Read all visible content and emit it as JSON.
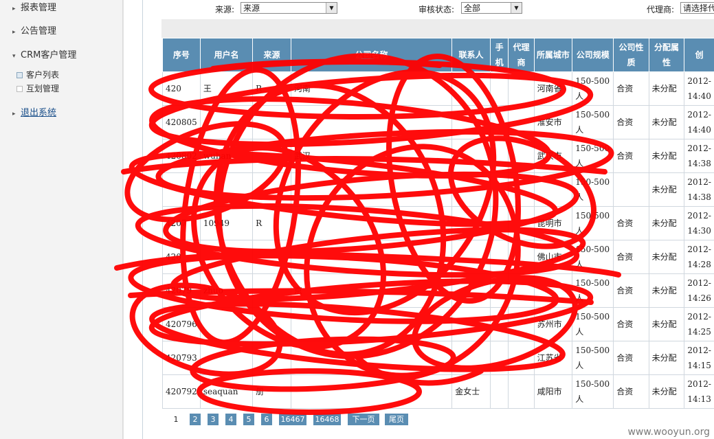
{
  "sidebar": {
    "items": [
      {
        "label": "报表管理",
        "arrow": "▸"
      },
      {
        "label": "公告管理",
        "arrow": "▸"
      },
      {
        "label": "CRM客户管理",
        "arrow": "▾"
      }
    ],
    "subitems": [
      {
        "label": "客户列表",
        "icon": "square-icon"
      },
      {
        "label": "互划管理",
        "icon": "square-icon"
      }
    ],
    "logout": {
      "label": "退出系统",
      "arrow": "▸"
    }
  },
  "filters": {
    "source": {
      "label": "来源:",
      "value": "来源"
    },
    "audit": {
      "label": "审核状态:",
      "value": "全部"
    },
    "agent": {
      "label": "代理商:",
      "value": "请选择代"
    }
  },
  "table": {
    "headers": [
      "序号",
      "用户名",
      "来源",
      "公司名称",
      "联系人",
      "手机",
      "代理商",
      "所属城市",
      "公司规模",
      "公司性质",
      "分配属性",
      "创"
    ],
    "rows": [
      [
        "420",
        "王",
        "R",
        "河南",
        "",
        "",
        "",
        "河南省",
        "150-500人",
        "合资",
        "未分配",
        "2012-14:40"
      ],
      [
        "420805",
        "",
        "",
        "",
        "",
        "",
        "",
        "淮安市",
        "150-500人",
        "合资",
        "未分配",
        "2012-14:40"
      ],
      [
        "420802",
        "wuhan",
        "",
        "武汉",
        "",
        "",
        "",
        "武汉市",
        "150-500人",
        "合资",
        "未分配",
        "2012-14:38"
      ],
      [
        "",
        "",
        "",
        "",
        "",
        "",
        "",
        "",
        "150-500人",
        "",
        "未分配",
        "2012-14:38"
      ],
      [
        "4207",
        "10949",
        "R",
        "",
        "",
        "",
        "",
        "昆明市",
        "150-500人",
        "合资",
        "未分配",
        "2012-14:30"
      ],
      [
        "420",
        "",
        "",
        "",
        "",
        "",
        "",
        "佛山市",
        "150-500人",
        "合资",
        "未分配",
        "2012-14:28"
      ],
      [
        "42079",
        "zhuo",
        "",
        "京",
        "",
        "",
        "",
        "",
        "150-500人",
        "合资",
        "未分配",
        "2012-14:26"
      ],
      [
        "420796",
        "",
        "",
        "",
        "",
        "",
        "",
        "苏州市",
        "150-500人",
        "合资",
        "未分配",
        "2012-14:25"
      ],
      [
        "420793",
        "",
        "",
        "",
        "",
        "",
        "",
        "江苏省",
        "150-500人",
        "合资",
        "未分配",
        "2012-14:15"
      ],
      [
        "420792",
        "seaquan",
        "册",
        "",
        "金女士",
        "",
        "",
        "咸阳市",
        "150-500人",
        "合资",
        "未分配",
        "2012-14:13"
      ]
    ]
  },
  "pager": {
    "pages": [
      "1",
      "2",
      "3",
      "4",
      "5",
      "6",
      "16467",
      "16468"
    ],
    "next": "下一页",
    "last": "尾页"
  },
  "watermark": "www.wooyun.org",
  "colors": {
    "header": "#5a8db2",
    "scribble": "#ff0000"
  }
}
